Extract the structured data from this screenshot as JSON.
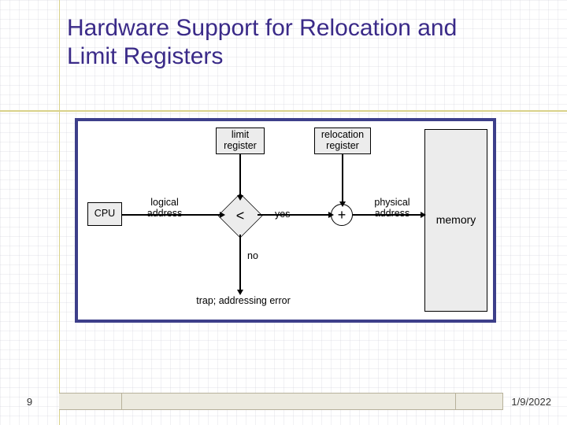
{
  "slide": {
    "title": "Hardware Support for Relocation and Limit Registers",
    "number": "9",
    "date": "1/9/2022"
  },
  "diagram": {
    "cpu": "CPU",
    "limit_register": "limit\nregister",
    "relocation_register": "relocation\nregister",
    "memory": "memory",
    "comparator": "<",
    "adder": "+",
    "logical_address": "logical\naddress",
    "physical_address": "physical\naddress",
    "yes": "yes",
    "no": "no",
    "trap": "trap; addressing error"
  }
}
